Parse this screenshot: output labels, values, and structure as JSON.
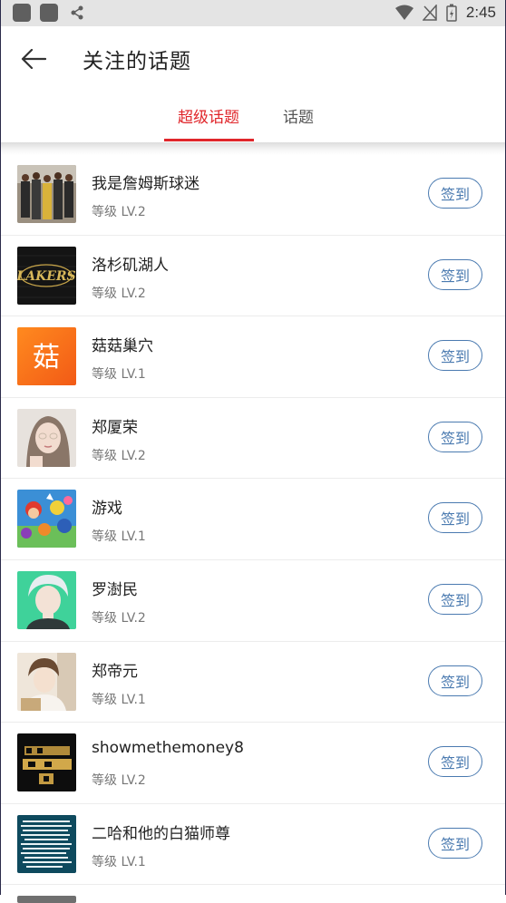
{
  "status_bar": {
    "time": "2:45"
  },
  "header": {
    "title": "关注的话题"
  },
  "tabs": [
    {
      "label": "超级话题"
    },
    {
      "label": "话题"
    }
  ],
  "topics": [
    {
      "name": "我是詹姆斯球迷",
      "level": "等级 LV.2",
      "button": "签到"
    },
    {
      "name": "洛杉矶湖人",
      "level": "等级 LV.2",
      "button": "签到"
    },
    {
      "name": "菇菇巢穴",
      "level": "等级 LV.1",
      "button": "签到",
      "icon_text": "菇"
    },
    {
      "name": "郑厦荣",
      "level": "等级 LV.2",
      "button": "签到"
    },
    {
      "name": "游戏",
      "level": "等级 LV.1",
      "button": "签到"
    },
    {
      "name": "罗澍民",
      "level": "等级 LV.2",
      "button": "签到"
    },
    {
      "name": "郑帝元",
      "level": "等级 LV.1",
      "button": "签到"
    },
    {
      "name": "showmethemoney8",
      "level": "等级 LV.2",
      "button": "签到"
    },
    {
      "name": "二哈和他的白猫师尊",
      "level": "等级 LV.1",
      "button": "签到"
    }
  ],
  "colors": {
    "accent": "#e0262b",
    "button_blue": "#4a7ab0"
  }
}
